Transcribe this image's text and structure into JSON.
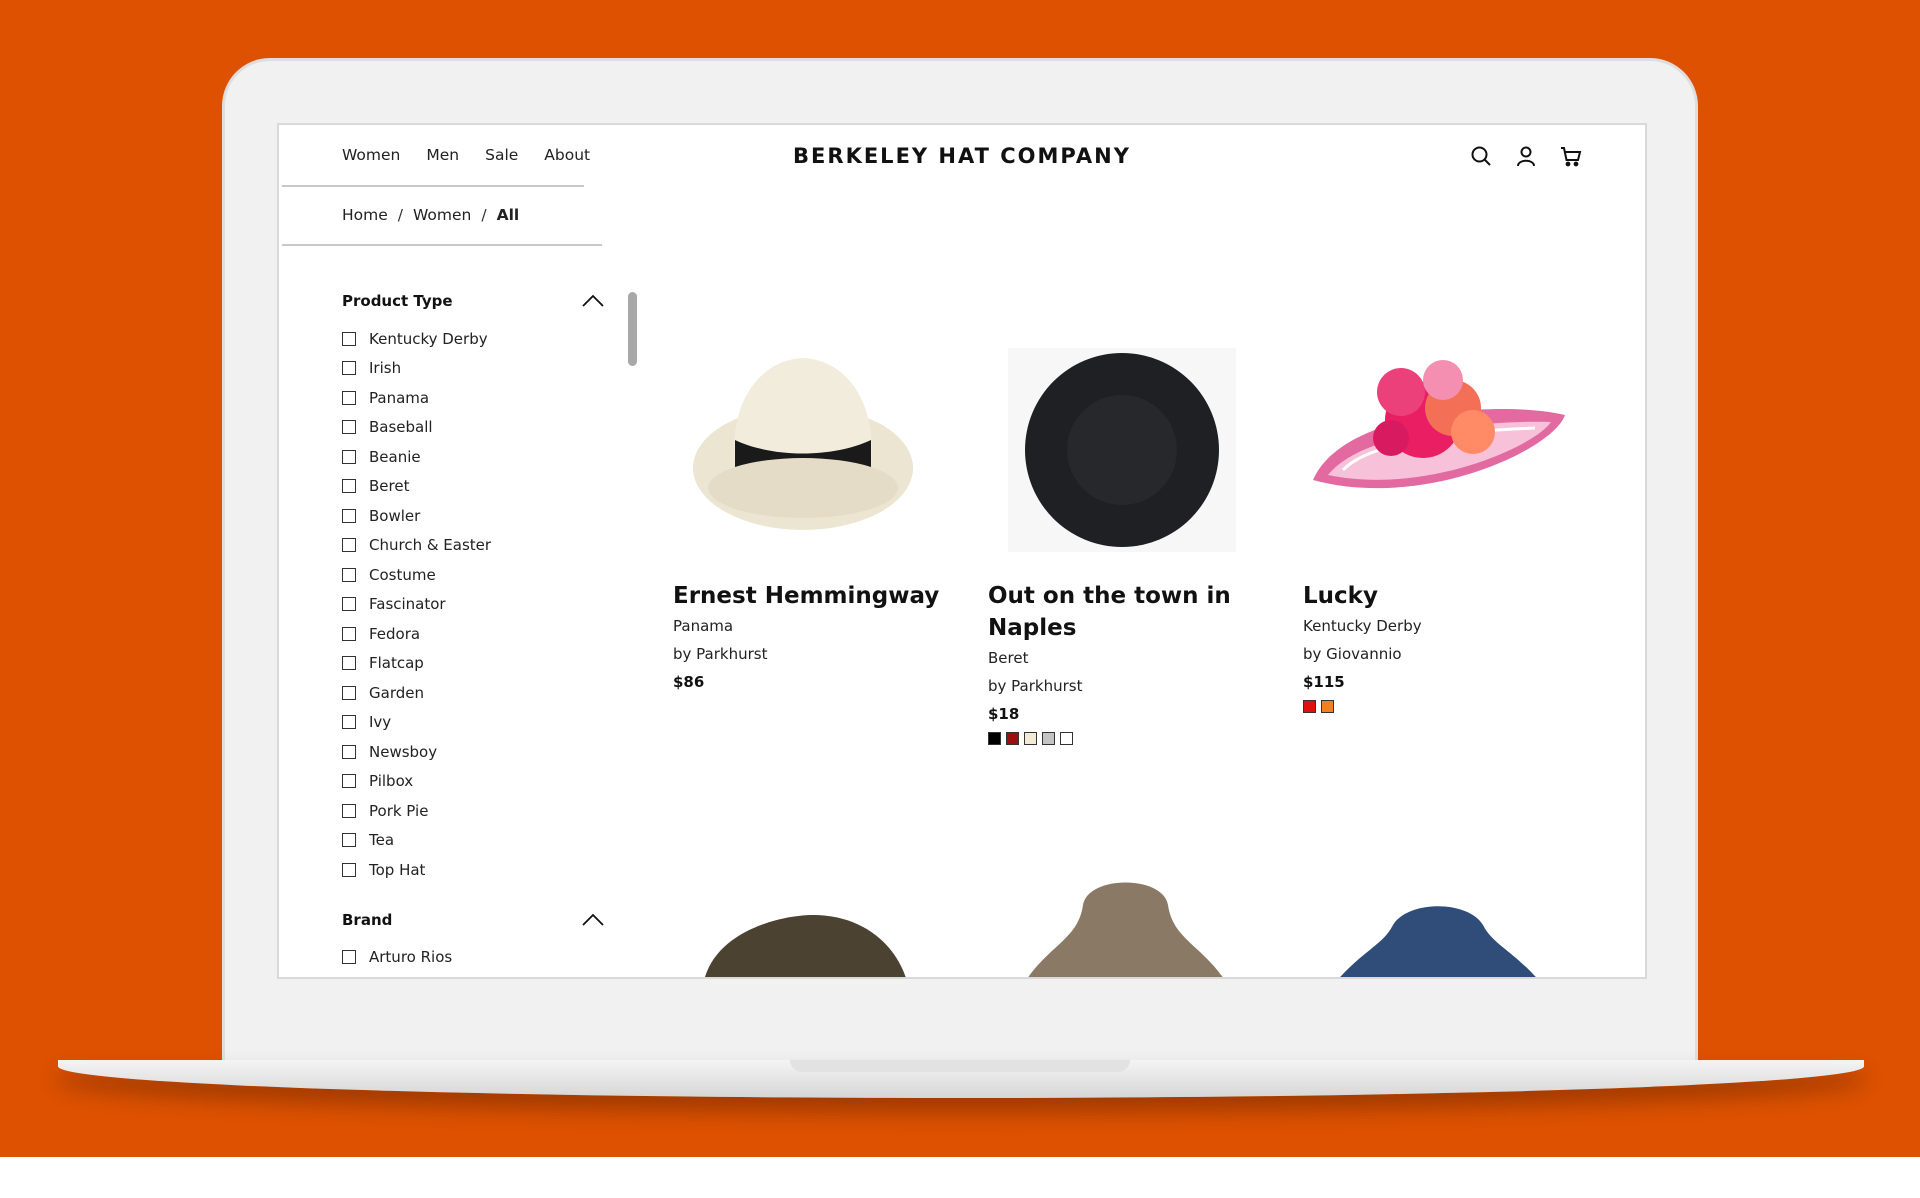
{
  "nav": {
    "items": [
      "Women",
      "Men",
      "Sale",
      "About"
    ]
  },
  "brand": "BERKELEY HAT COMPANY",
  "header_icons": [
    "search-icon",
    "user-icon",
    "cart-icon"
  ],
  "breadcrumb": {
    "home": "Home",
    "section": "Women",
    "current": "All",
    "separator": "/"
  },
  "filters": {
    "product_type": {
      "title": "Product Type",
      "options": [
        "Kentucky Derby",
        "Irish",
        "Panama",
        "Baseball",
        "Beanie",
        "Beret",
        "Bowler",
        "Church & Easter",
        "Costume",
        "Fascinator",
        "Fedora",
        "Flatcap",
        "Garden",
        "Ivy",
        "Newsboy",
        "Pilbox",
        "Pork Pie",
        "Tea",
        "Top Hat"
      ]
    },
    "brand": {
      "title": "Brand",
      "options": [
        "Arturo Rios"
      ]
    }
  },
  "products": [
    {
      "name": "Ernest Hemmingway",
      "type": "Panama",
      "maker": "by Parkhurst",
      "price": "$86",
      "swatches": []
    },
    {
      "name": "Out on the town in Naples",
      "type": "Beret",
      "maker": "by Parkhurst",
      "price": "$18",
      "swatches": [
        "#000000",
        "#9b0f0f",
        "#f1ead6",
        "#c4c4c4",
        "#ffffff"
      ]
    },
    {
      "name": "Lucky",
      "type": "Kentucky Derby",
      "maker": "by Giovannio",
      "price": "$115",
      "swatches": [
        "#e01010",
        "#f08020"
      ]
    }
  ],
  "colors": {
    "background": "#DD5100",
    "text": "#111111"
  }
}
